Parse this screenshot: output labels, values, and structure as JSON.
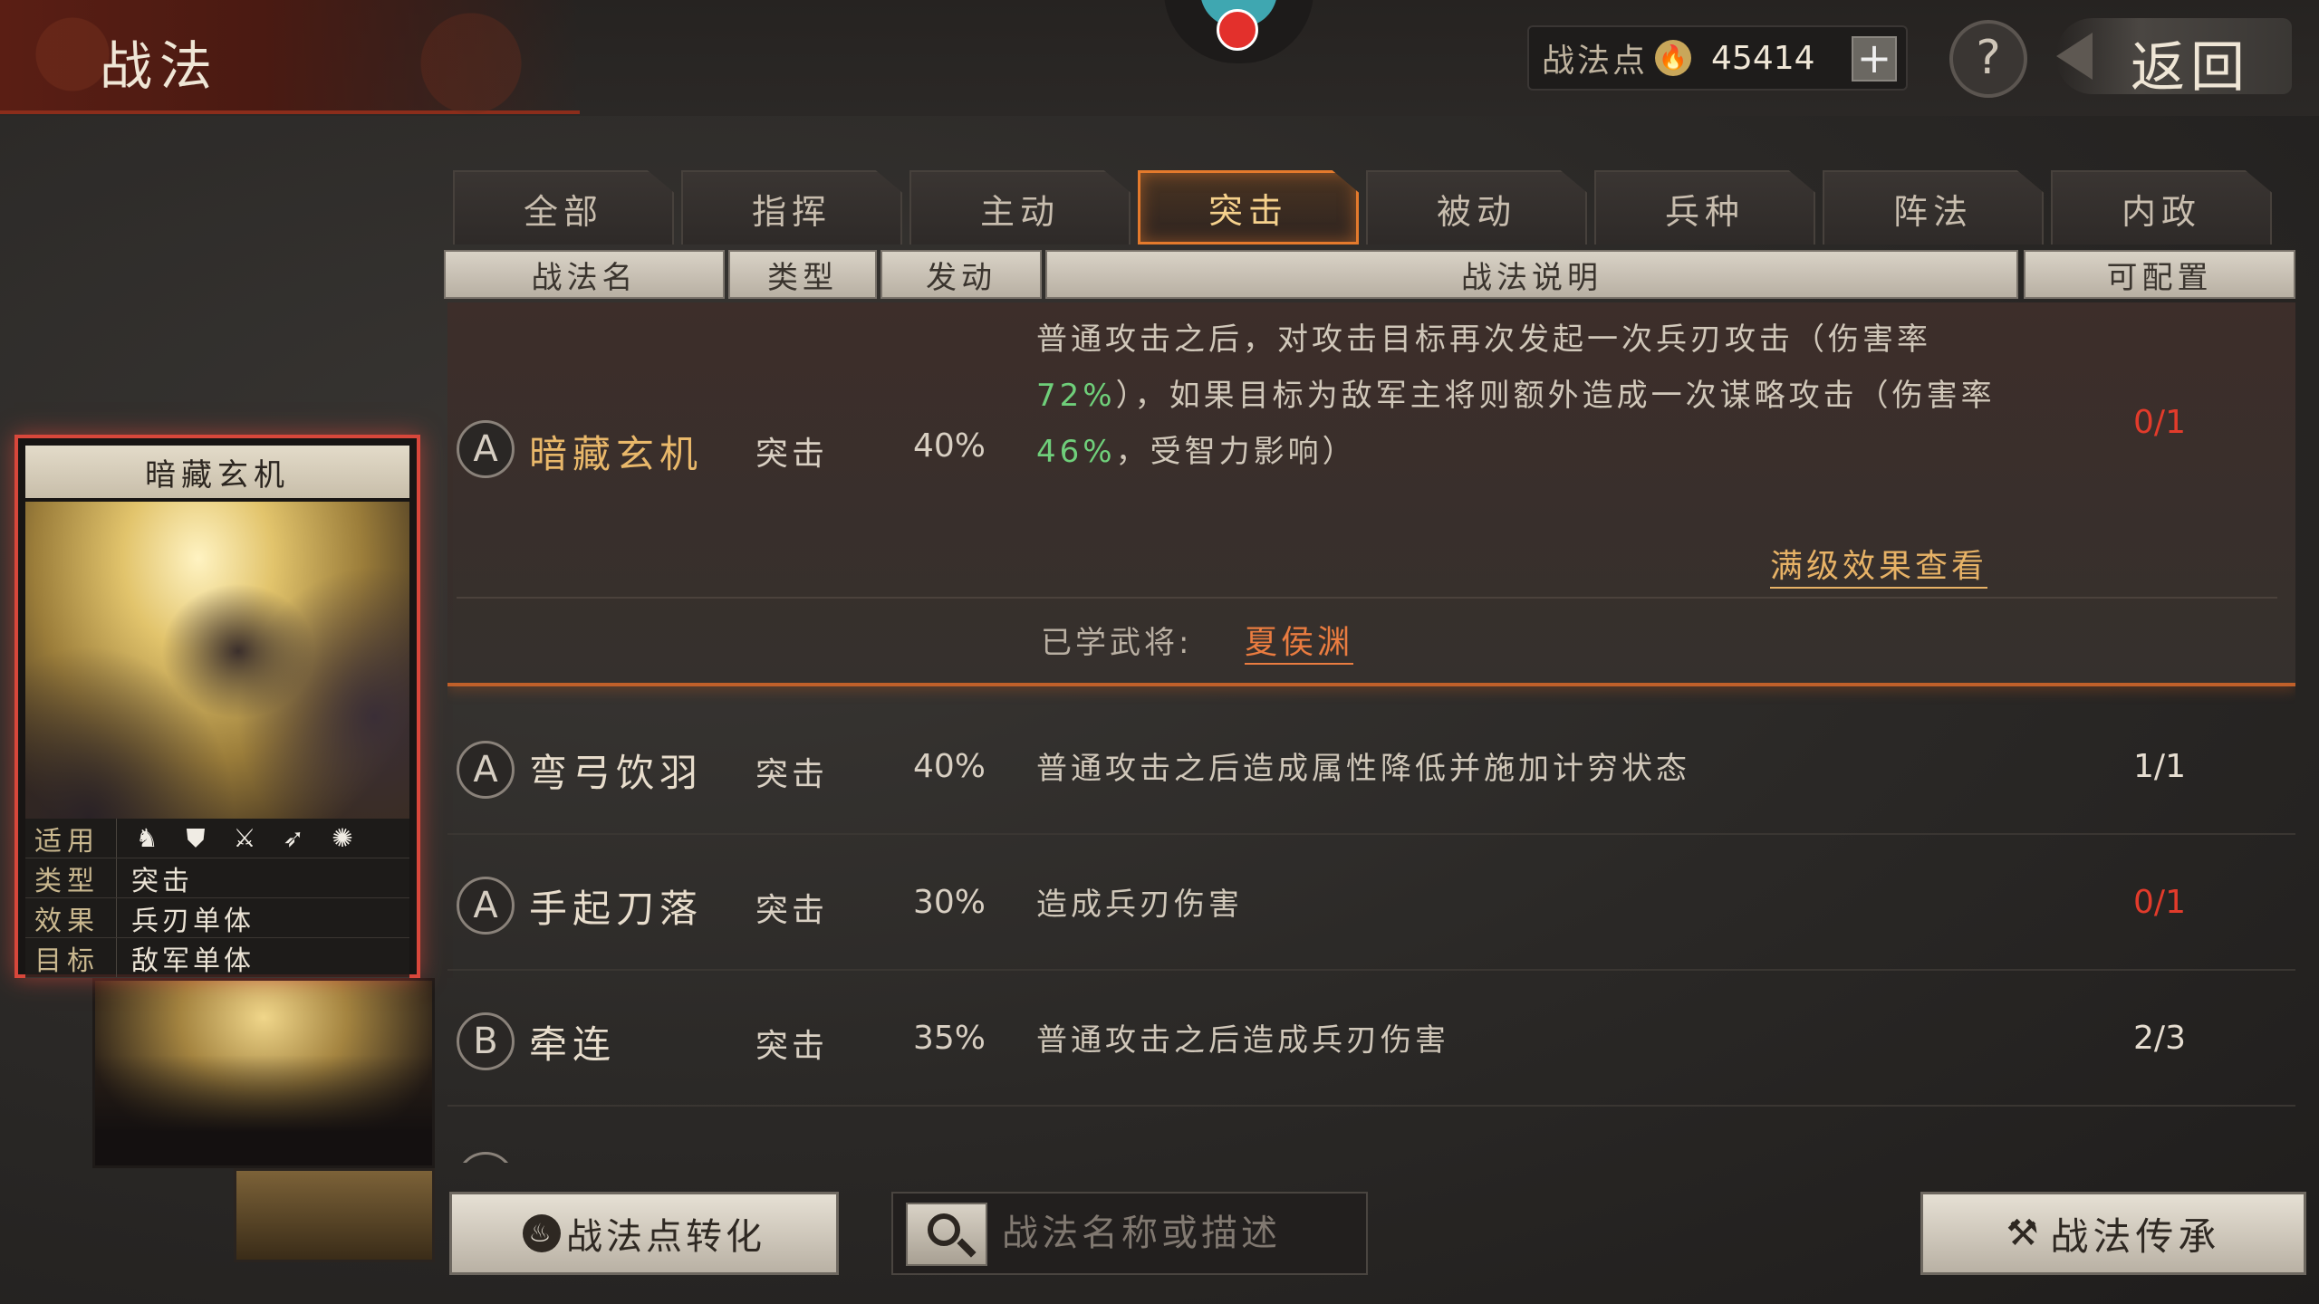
{
  "header": {
    "title": "战法",
    "points_label": "战法点",
    "points_value": "45414",
    "plus_label": "+",
    "help_label": "?",
    "back_label": "返回"
  },
  "tabs": [
    {
      "label": "全部",
      "active": false
    },
    {
      "label": "指挥",
      "active": false
    },
    {
      "label": "主动",
      "active": false
    },
    {
      "label": "突击",
      "active": true
    },
    {
      "label": "被动",
      "active": false
    },
    {
      "label": "兵种",
      "active": false
    },
    {
      "label": "阵法",
      "active": false
    },
    {
      "label": "内政",
      "active": false
    }
  ],
  "columns": {
    "name": "战法名",
    "type": "类型",
    "rate": "发动",
    "desc": "战法说明",
    "conf": "可配置"
  },
  "skills": [
    {
      "grade": "A",
      "name": "暗藏玄机",
      "type": "突击",
      "rate": "40%",
      "desc_parts": [
        "普通攻击之后，对攻击目标再次发起一次兵刃攻击（伤害率",
        "72%",
        "），如果目标为敌军主将则额外造成一次谋略攻击（伤害率",
        "46%",
        "，受智力影响）"
      ],
      "conf": "0/1",
      "full_view": "满级效果查看",
      "learned_label": "已学武将:",
      "learned_general": "夏侯渊"
    },
    {
      "grade": "A",
      "name": "弯弓饮羽",
      "type": "突击",
      "rate": "40%",
      "desc": "普通攻击之后造成属性降低并施加计穷状态",
      "conf": "1/1"
    },
    {
      "grade": "A",
      "name": "手起刀落",
      "type": "突击",
      "rate": "30%",
      "desc": "造成兵刃伤害",
      "conf": "0/1"
    },
    {
      "grade": "B",
      "name": "牵连",
      "type": "突击",
      "rate": "35%",
      "desc": "普通攻击之后造成兵刃伤害",
      "conf": "2/3"
    }
  ],
  "card": {
    "title": "暗藏玄机",
    "applicable_key": "适用",
    "troop_icons": [
      "cavalry-icon",
      "shield-icon",
      "crossed-swords-icon",
      "bow-icon",
      "wheel-icon"
    ],
    "type_key": "类型",
    "type_val": "突击",
    "effect_key": "效果",
    "effect_val": "兵刃单体",
    "target_key": "目标",
    "target_val": "敌军单体"
  },
  "footer": {
    "convert_label": "战法点转化",
    "search_placeholder": "战法名称或描述",
    "inherit_label": "战法传承"
  },
  "colors": {
    "accent_orange": "#e47a2c",
    "highlight_green": "#6fcf7a",
    "conf_red": "#e23b2b",
    "gold_text": "#e9b86a"
  }
}
